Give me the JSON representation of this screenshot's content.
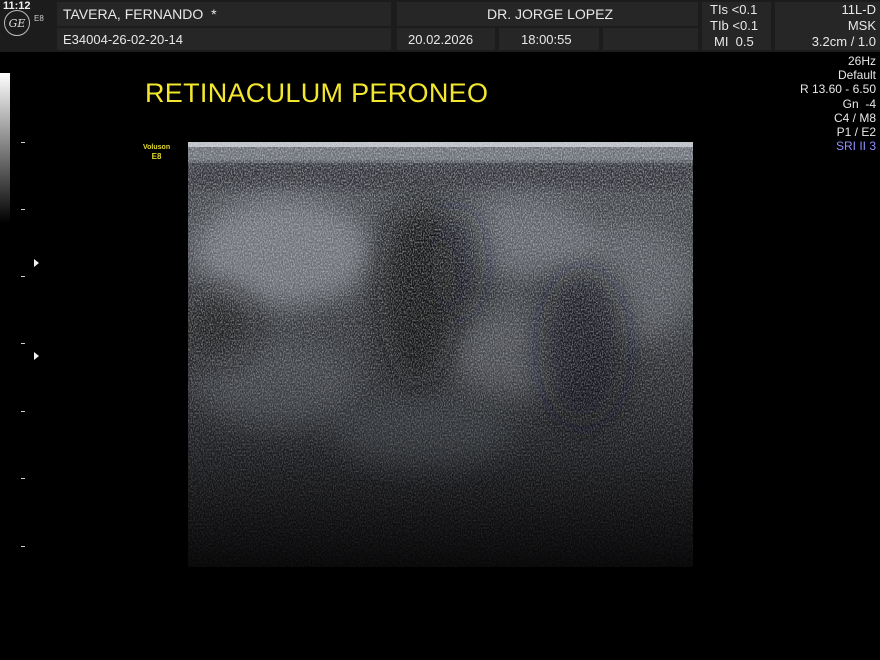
{
  "header": {
    "clock": "11:12",
    "logo_letters": "GE",
    "device_tag": "E8",
    "patient_name": "TAVERA, FERNANDO",
    "patient_flag": "*",
    "patient_id": "E34004-26-02-20-14",
    "physician": "DR. JORGE LOPEZ",
    "date": "20.02.2026",
    "time": "18:00:55",
    "tis": "TIs <0.1",
    "tib": "TIb <0.1",
    "mi": "MI  0.5",
    "probe": "11L-D",
    "preset": "MSK",
    "depth": "3.2cm / 1.0"
  },
  "settings": [
    "26Hz",
    "Default",
    "R 13.60 - 6.50",
    "Gn  -4",
    "C4 / M8",
    "P1 / E2"
  ],
  "sri_label": "SRI II 3",
  "annotation": {
    "title": "RETINACULUM PERONEO",
    "brand": "Voluson",
    "model": "E8"
  },
  "colors": {
    "annotation": "#f2e62f",
    "sri": "#8f8fff",
    "header_bg": "#1c1c1c"
  }
}
